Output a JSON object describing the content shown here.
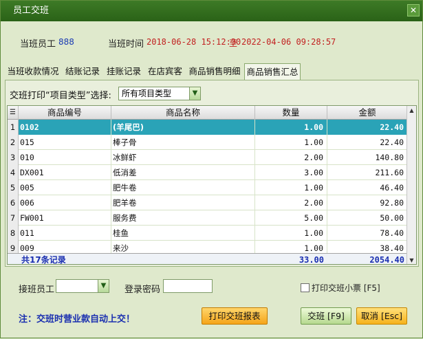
{
  "window": {
    "title": "员工交班",
    "close": "✕"
  },
  "shift": {
    "employee_label": "当班员工",
    "employee_value": "888",
    "time_label": "当班时间",
    "time_start": "2018-06-28 15:12:30",
    "time_to": "至",
    "time_end": "2022-04-06 09:28:57"
  },
  "tabs": [
    "当班收款情况",
    "结账记录",
    "挂账记录",
    "在店宾客",
    "商品销售明细",
    "商品销售汇总"
  ],
  "active_tab": "商品销售汇总",
  "filter": {
    "label": "交班打印“项目类型”选择:",
    "value": "所有项目类型"
  },
  "table": {
    "headers": [
      "商品编号",
      "商品名称",
      "数量",
      "金额"
    ],
    "rows": [
      {
        "num": "1",
        "code": "0102",
        "name": "(羊尾巴)",
        "qty": "1.00",
        "amount": "22.40"
      },
      {
        "num": "2",
        "code": "015",
        "name": "棒子骨",
        "qty": "1.00",
        "amount": "22.40"
      },
      {
        "num": "3",
        "code": "010",
        "name": "冰鲜虾",
        "qty": "2.00",
        "amount": "140.80"
      },
      {
        "num": "4",
        "code": "DX001",
        "name": "低消差",
        "qty": "3.00",
        "amount": "211.60"
      },
      {
        "num": "5",
        "code": "005",
        "name": "肥牛卷",
        "qty": "1.00",
        "amount": "46.40"
      },
      {
        "num": "6",
        "code": "006",
        "name": "肥羊卷",
        "qty": "2.00",
        "amount": "92.80"
      },
      {
        "num": "7",
        "code": "FW001",
        "name": "服务费",
        "qty": "5.00",
        "amount": "50.00"
      },
      {
        "num": "8",
        "code": "011",
        "name": "桂鱼",
        "qty": "1.00",
        "amount": "78.40"
      },
      {
        "num": "9",
        "code": "009",
        "name": "来沙",
        "qty": "1.00",
        "amount": "38.40"
      }
    ],
    "summary": {
      "label": "共17条记录",
      "qty": "33.00",
      "amount": "2054.40"
    }
  },
  "handover": {
    "employee_label": "接班员工",
    "password_label": "登录密码",
    "print_ticket_label": "打印交班小票 [F5]",
    "print_report_button": "打印交班报表",
    "confirm_button": "交班 [F9]",
    "cancel_button": "取消 [Esc]",
    "note": "注：交班时营业款自动上交！"
  }
}
